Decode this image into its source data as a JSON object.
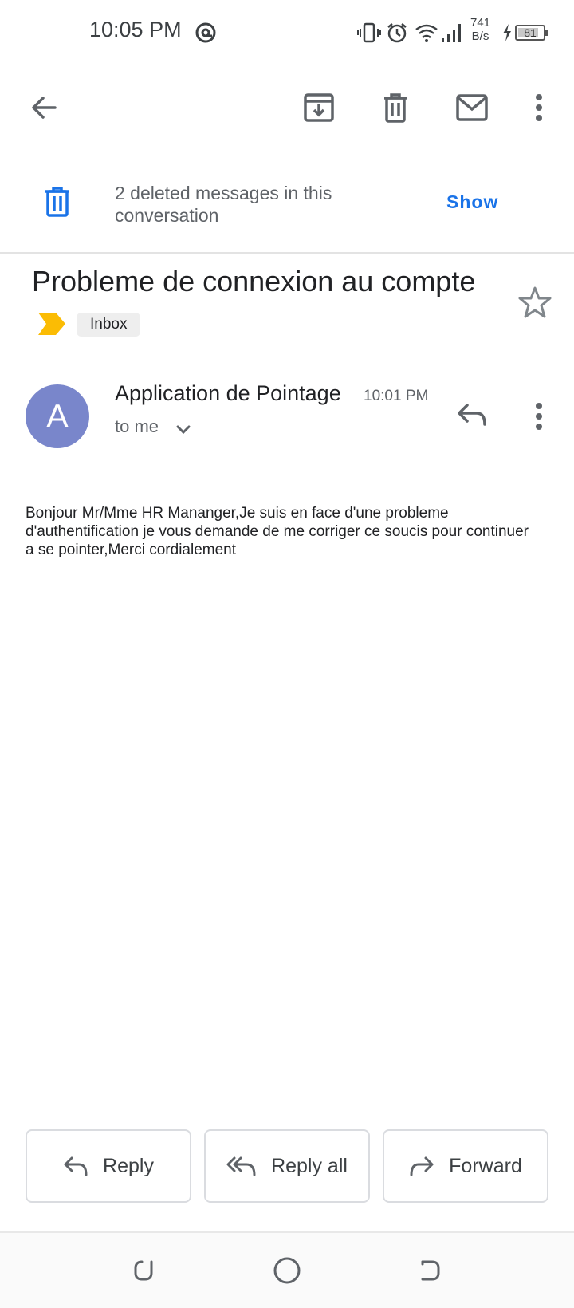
{
  "status_bar": {
    "time": "10:05 PM",
    "speed_value": "741",
    "speed_unit": "B/s",
    "battery": "81",
    "icons": [
      "at-sign-icon",
      "vibrate-icon",
      "alarm-icon",
      "wifi-icon",
      "signal-icon",
      "charging-icon",
      "battery-icon"
    ]
  },
  "toolbar": {
    "icons": [
      "back-arrow-icon",
      "archive-icon",
      "delete-icon",
      "mark-unread-icon",
      "more-vert-icon"
    ]
  },
  "banner": {
    "text": "2 deleted messages in this conversation",
    "action": "Show"
  },
  "email": {
    "subject": "Probleme de connexion au compte",
    "label": "Inbox",
    "sender": "Application de Pointage",
    "avatar_letter": "A",
    "time": "10:01 PM",
    "recipient": "to me",
    "body": "Bonjour Mr/Mme HR Mananger,Je suis en face d'une probleme d'authentification je vous demande de me corriger ce soucis pour continuer a se pointer,Merci cordialement"
  },
  "actions": {
    "reply": "Reply",
    "reply_all": "Reply all",
    "forward": "Forward"
  },
  "colors": {
    "accent": "#1a73e8",
    "avatar": "#7986cb",
    "importance": "#fbbc04",
    "icon": "#5f6368"
  }
}
